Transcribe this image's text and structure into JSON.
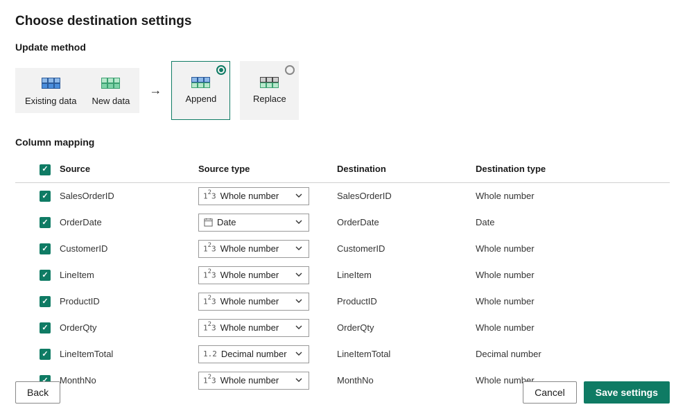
{
  "title": "Choose destination settings",
  "sections": {
    "update": "Update method",
    "mapping": "Column mapping"
  },
  "legend": {
    "existing": "Existing data",
    "newdata": "New data"
  },
  "methods": {
    "append": "Append",
    "replace": "Replace",
    "selected": "append"
  },
  "headers": {
    "source": "Source",
    "source_type": "Source type",
    "destination": "Destination",
    "destination_type": "Destination type"
  },
  "type_labels": {
    "whole": "Whole number",
    "date": "Date",
    "decimal": "Decimal number"
  },
  "rows": [
    {
      "source": "SalesOrderID",
      "source_type": "whole",
      "destination": "SalesOrderID",
      "destination_type": "Whole number"
    },
    {
      "source": "OrderDate",
      "source_type": "date",
      "destination": "OrderDate",
      "destination_type": "Date"
    },
    {
      "source": "CustomerID",
      "source_type": "whole",
      "destination": "CustomerID",
      "destination_type": "Whole number"
    },
    {
      "source": "LineItem",
      "source_type": "whole",
      "destination": "LineItem",
      "destination_type": "Whole number"
    },
    {
      "source": "ProductID",
      "source_type": "whole",
      "destination": "ProductID",
      "destination_type": "Whole number"
    },
    {
      "source": "OrderQty",
      "source_type": "whole",
      "destination": "OrderQty",
      "destination_type": "Whole number"
    },
    {
      "source": "LineItemTotal",
      "source_type": "decimal",
      "destination": "LineItemTotal",
      "destination_type": "Decimal number"
    },
    {
      "source": "MonthNo",
      "source_type": "whole",
      "destination": "MonthNo",
      "destination_type": "Whole number"
    }
  ],
  "buttons": {
    "back": "Back",
    "cancel": "Cancel",
    "save": "Save settings"
  }
}
